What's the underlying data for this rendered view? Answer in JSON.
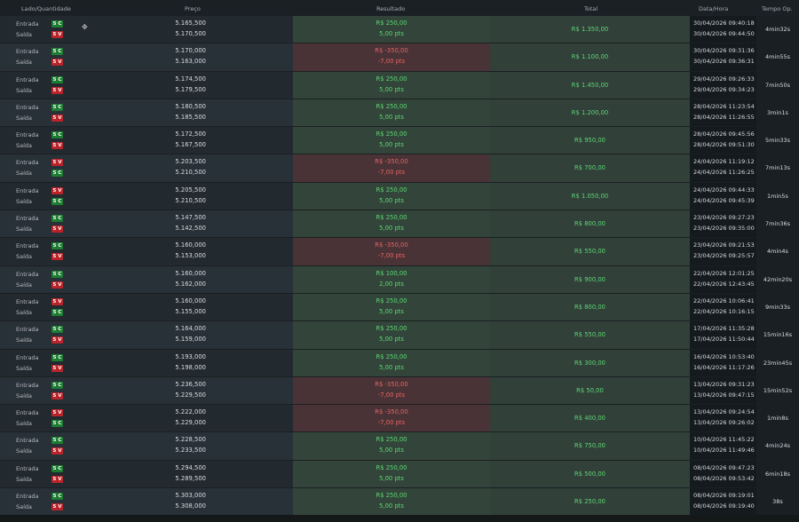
{
  "headers": {
    "side": "Lado/Quantidade",
    "price": "Preço",
    "result": "Resultado",
    "total": "Total",
    "datetime": "Data/Hora",
    "duration": "Tempo Op."
  },
  "labels": {
    "entry": "Entrada",
    "exit": "Saída"
  },
  "colors": {
    "buy": "#1f7d33",
    "sell": "#b8242a",
    "positive": "#5cd673",
    "negative": "#e06464"
  },
  "rows": [
    {
      "entry_badge": "5 C",
      "exit_badge": "5 V",
      "entry_price": "5.165,500",
      "exit_price": "5.170,500",
      "result": "R$ 250,00",
      "points": "5,00 pts",
      "positive": true,
      "total": "R$ 1.350,00",
      "entry_time": "30/04/2026 09:40:18",
      "exit_time": "30/04/2026 09:44:50",
      "duration": "4min32s"
    },
    {
      "entry_badge": "5 C",
      "exit_badge": "5 V",
      "entry_price": "5.170,000",
      "exit_price": "5.163,000",
      "result": "R$ -350,00",
      "points": "-7,00 pts",
      "positive": false,
      "total": "R$ 1.100,00",
      "entry_time": "30/04/2026 09:31:36",
      "exit_time": "30/04/2026 09:36:31",
      "duration": "4min55s"
    },
    {
      "entry_badge": "5 C",
      "exit_badge": "5 V",
      "entry_price": "5.174,500",
      "exit_price": "5.179,500",
      "result": "R$ 250,00",
      "points": "5,00 pts",
      "positive": true,
      "total": "R$ 1.450,00",
      "entry_time": "29/04/2026 09:26:33",
      "exit_time": "29/04/2026 09:34:23",
      "duration": "7min50s"
    },
    {
      "entry_badge": "5 C",
      "exit_badge": "5 V",
      "entry_price": "5.180,500",
      "exit_price": "5.185,500",
      "result": "R$ 250,00",
      "points": "5,00 pts",
      "positive": true,
      "total": "R$ 1.200,00",
      "entry_time": "28/04/2026 11:23:54",
      "exit_time": "28/04/2026 11:26:55",
      "duration": "3min1s"
    },
    {
      "entry_badge": "5 C",
      "exit_badge": "5 V",
      "entry_price": "5.172,500",
      "exit_price": "5.167,500",
      "result": "R$ 250,00",
      "points": "5,00 pts",
      "positive": true,
      "total": "R$ 950,00",
      "entry_time": "28/04/2026 09:45:56",
      "exit_time": "28/04/2026 09:51:30",
      "duration": "5min33s"
    },
    {
      "entry_badge": "5 V",
      "exit_badge": "5 C",
      "entry_price": "5.203,500",
      "exit_price": "5.210,500",
      "result": "R$ -350,00",
      "points": "-7,00 pts",
      "positive": false,
      "total": "R$ 700,00",
      "entry_time": "24/04/2026 11:19:12",
      "exit_time": "24/04/2026 11:26:25",
      "duration": "7min13s"
    },
    {
      "entry_badge": "5 V",
      "exit_badge": "5 C",
      "entry_price": "5.205,500",
      "exit_price": "5.210,500",
      "result": "R$ 250,00",
      "points": "5,00 pts",
      "positive": true,
      "total": "R$ 1.050,00",
      "entry_time": "24/04/2026 09:44:33",
      "exit_time": "24/04/2026 09:45:39",
      "duration": "1min5s"
    },
    {
      "entry_badge": "5 C",
      "exit_badge": "5 V",
      "entry_price": "5.147,500",
      "exit_price": "5.142,500",
      "result": "R$ 250,00",
      "points": "5,00 pts",
      "positive": true,
      "total": "R$ 800,00",
      "entry_time": "23/04/2026 09:27:23",
      "exit_time": "23/04/2026 09:35:00",
      "duration": "7min36s"
    },
    {
      "entry_badge": "5 C",
      "exit_badge": "5 V",
      "entry_price": "5.160,000",
      "exit_price": "5.153,000",
      "result": "R$ -350,00",
      "points": "-7,00 pts",
      "positive": false,
      "total": "R$ 550,00",
      "entry_time": "23/04/2026 09:21:53",
      "exit_time": "23/04/2026 09:25:57",
      "duration": "4min4s"
    },
    {
      "entry_badge": "5 C",
      "exit_badge": "5 V",
      "entry_price": "5.160,000",
      "exit_price": "5.162,000",
      "result": "R$ 100,00",
      "points": "2,00 pts",
      "positive": true,
      "total": "R$ 900,00",
      "entry_time": "22/04/2026 12:01:25",
      "exit_time": "22/04/2026 12:43:45",
      "duration": "42min20s"
    },
    {
      "entry_badge": "5 V",
      "exit_badge": "5 C",
      "entry_price": "5.160,000",
      "exit_price": "5.155,000",
      "result": "R$ 250,00",
      "points": "5,00 pts",
      "positive": true,
      "total": "R$ 800,00",
      "entry_time": "22/04/2026 10:06:41",
      "exit_time": "22/04/2026 10:16:15",
      "duration": "9min33s"
    },
    {
      "entry_badge": "5 C",
      "exit_badge": "5 V",
      "entry_price": "5.164,000",
      "exit_price": "5.159,000",
      "result": "R$ 250,00",
      "points": "5,00 pts",
      "positive": true,
      "total": "R$ 550,00",
      "entry_time": "17/04/2026 11:35:28",
      "exit_time": "17/04/2026 11:50:44",
      "duration": "15min16s"
    },
    {
      "entry_badge": "5 C",
      "exit_badge": "5 V",
      "entry_price": "5.193,000",
      "exit_price": "5.198,000",
      "result": "R$ 250,00",
      "points": "5,00 pts",
      "positive": true,
      "total": "R$ 300,00",
      "entry_time": "16/04/2026 10:53:40",
      "exit_time": "16/04/2026 11:17:26",
      "duration": "23min45s"
    },
    {
      "entry_badge": "5 C",
      "exit_badge": "5 V",
      "entry_price": "5.236,500",
      "exit_price": "5.229,500",
      "result": "R$ -350,00",
      "points": "-7,00 pts",
      "positive": false,
      "total": "R$ 50,00",
      "entry_time": "13/04/2026 09:31:23",
      "exit_time": "13/04/2026 09:47:15",
      "duration": "15min52s"
    },
    {
      "entry_badge": "5 V",
      "exit_badge": "5 C",
      "entry_price": "5.222,000",
      "exit_price": "5.229,000",
      "result": "R$ -350,00",
      "points": "-7,00 pts",
      "positive": false,
      "total": "R$ 400,00",
      "entry_time": "13/04/2026 09:24:54",
      "exit_time": "13/04/2026 09:26:02",
      "duration": "1min8s"
    },
    {
      "entry_badge": "5 C",
      "exit_badge": "5 V",
      "entry_price": "5.228,500",
      "exit_price": "5.233,500",
      "result": "R$ 250,00",
      "points": "5,00 pts",
      "positive": true,
      "total": "R$ 750,00",
      "entry_time": "10/04/2026 11:45:22",
      "exit_time": "10/04/2026 11:49:46",
      "duration": "4min24s"
    },
    {
      "entry_badge": "5 C",
      "exit_badge": "5 V",
      "entry_price": "5.294,500",
      "exit_price": "5.289,500",
      "result": "R$ 250,00",
      "points": "5,00 pts",
      "positive": true,
      "total": "R$ 500,00",
      "entry_time": "08/04/2026 09:47:23",
      "exit_time": "08/04/2026 09:53:42",
      "duration": "6min18s"
    },
    {
      "entry_badge": "5 C",
      "exit_badge": "5 V",
      "entry_price": "5.303,000",
      "exit_price": "5.308,000",
      "result": "R$ 250,00",
      "points": "5,00 pts",
      "positive": true,
      "total": "R$ 250,00",
      "entry_time": "08/04/2026 09:19:01",
      "exit_time": "08/04/2026 09:19:40",
      "duration": "38s"
    }
  ]
}
